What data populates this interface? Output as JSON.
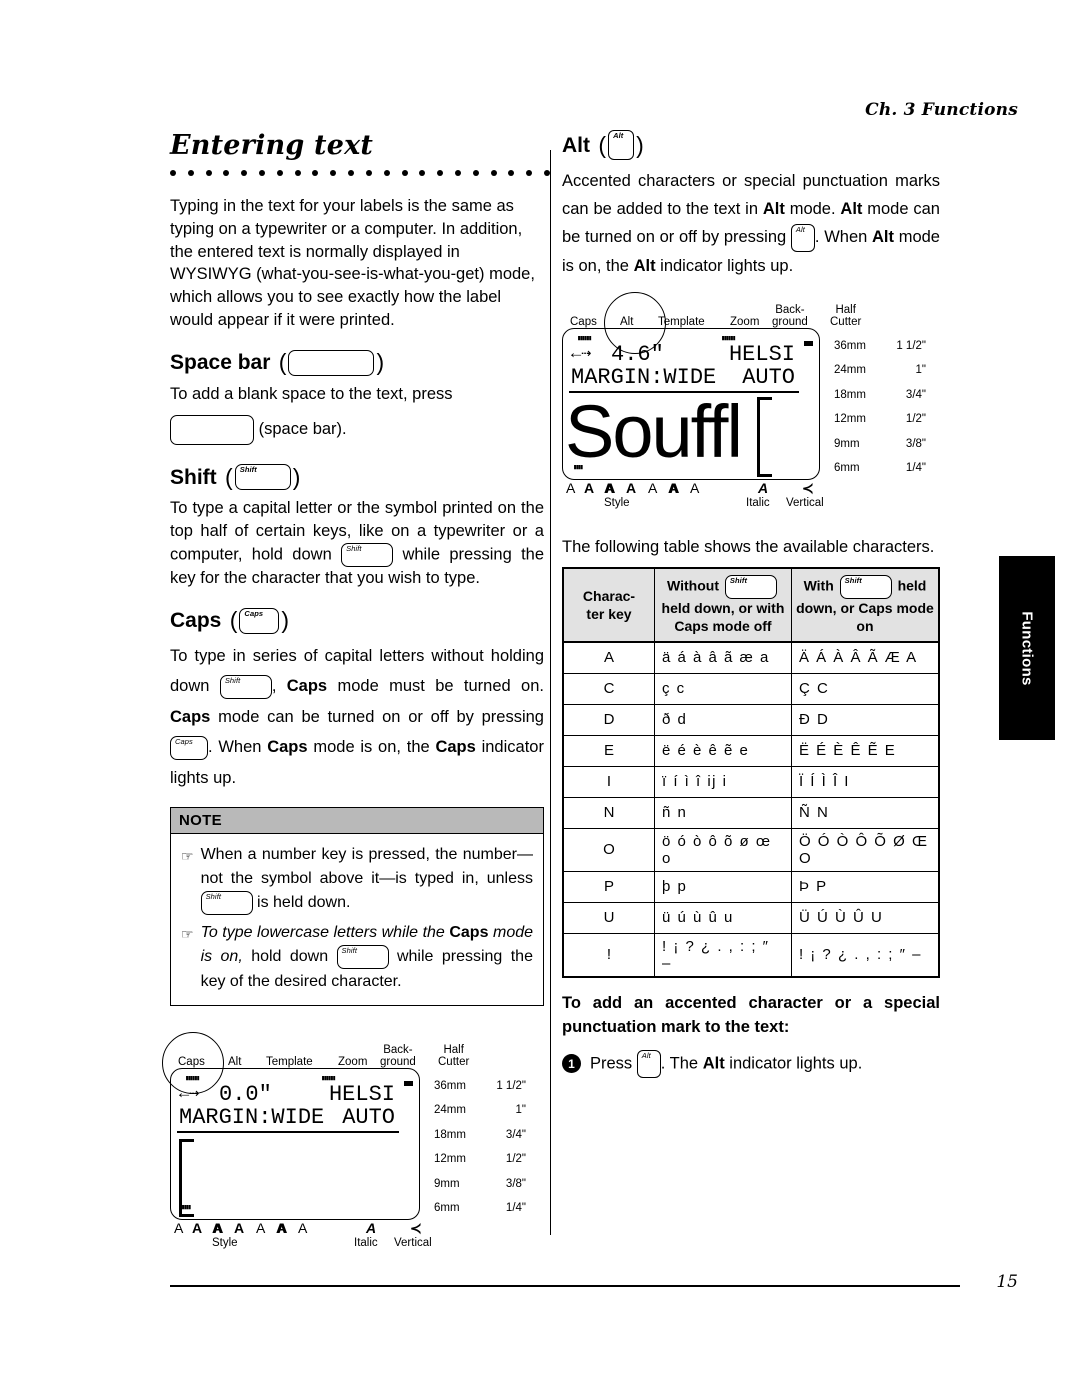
{
  "running_head": "Ch. 3 Functions",
  "page_number": "15",
  "side_tab": {
    "label": "Functions"
  },
  "left_column": {
    "section_title": "Entering text",
    "intro_paragraph": "Typing in the text for your labels is the same as typing on a typewriter or a computer. In addition, the entered text is normally displayed in WYSIWYG (what-you-see-is-what-you-get) mode, which allows you to see exactly how the label would appear if it were printed.",
    "space_bar": {
      "heading": "Space bar",
      "key_label": "",
      "text_before": "To add a blank space to the text, press",
      "text_after": "(space bar)."
    },
    "shift": {
      "heading": "Shift",
      "key_label": "Shift",
      "text_part1": "To type a capital letter or the symbol printed on the top half of certain keys, like on a typewriter or a computer, hold down",
      "text_part2": "while pressing the key for the character that you wish to type."
    },
    "caps": {
      "heading": "Caps",
      "key_label": "Caps",
      "text_part1": "To type in series of capital letters without holding down",
      "text_part2": ",",
      "text_part3": "mode must be turned on.",
      "text_part4": "mode can be turned on or off by pressing",
      "text_part5": ". When",
      "text_part6": "mode is on, the",
      "text_part7": "indicator lights up.",
      "bold_caps": "Caps"
    },
    "note": {
      "title": "NOTE",
      "item1_part1": "When a number key is pressed, the number—not the symbol above it—is typed in, unless",
      "item1_part2": "is held down.",
      "item2_part1": "To type lowercase letters while the",
      "item2_bold": "Caps",
      "item2_part2": "mode is on,",
      "item2_part3": "hold down",
      "item2_part4": "while pressing the key of the desired character."
    },
    "lcd": {
      "indicators": [
        "Caps",
        "Alt",
        "Template",
        "Zoom",
        "Back-\nground",
        "Half\nCutter"
      ],
      "highlighted_indicator": "Caps",
      "length_value": "0.0\"",
      "font_value": "HELSI",
      "margin_line": "MARGIN:WIDE",
      "size_value": "AUTO",
      "display_text": "",
      "tape_scale": [
        {
          "mm": "36mm",
          "inch": "1 1/2\""
        },
        {
          "mm": "24mm",
          "inch": "1\""
        },
        {
          "mm": "18mm",
          "inch": "3/4\""
        },
        {
          "mm": "12mm",
          "inch": "1/2\""
        },
        {
          "mm": "9mm",
          "inch": "3/8\""
        },
        {
          "mm": "6mm",
          "inch": "1/4\""
        }
      ],
      "style_glyphs": [
        "A",
        "A",
        "A",
        "A",
        "A",
        "A",
        "A"
      ],
      "style_caption": "Style",
      "italic_glyph": "A",
      "italic_caption": "Italic",
      "vertical_glyph": "≺",
      "vertical_caption": "Vertical"
    }
  },
  "right_column": {
    "alt": {
      "heading": "Alt",
      "key_label": "Alt",
      "text_part1": "Accented characters or special punctuation marks can be added to the text in",
      "bold_alt": "Alt",
      "text_part2": "mode.",
      "text_part3": "mode can be turned on or off by pressing",
      "text_part4": ". When",
      "text_part5": "mode is on, the",
      "text_part6": "indicator lights up."
    },
    "lcd": {
      "indicators": [
        "Caps",
        "Alt",
        "Template",
        "Zoom",
        "Back-\nground",
        "Half\nCutter"
      ],
      "highlighted_indicator": "Alt",
      "length_value": "4.6\"",
      "font_value": "HELSI",
      "margin_line": "MARGIN:WIDE",
      "size_value": "AUTO",
      "display_text": "Souffl",
      "tape_scale": [
        {
          "mm": "36mm",
          "inch": "1 1/2\""
        },
        {
          "mm": "24mm",
          "inch": "1\""
        },
        {
          "mm": "18mm",
          "inch": "3/4\""
        },
        {
          "mm": "12mm",
          "inch": "1/2\""
        },
        {
          "mm": "9mm",
          "inch": "3/8\""
        },
        {
          "mm": "6mm",
          "inch": "1/4\""
        }
      ],
      "style_glyphs": [
        "A",
        "A",
        "A",
        "A",
        "A",
        "A",
        "A"
      ],
      "style_caption": "Style",
      "italic_glyph": "A",
      "italic_caption": "Italic",
      "vertical_glyph": "≺",
      "vertical_caption": "Vertical"
    },
    "table_intro": "The following table shows the available characters.",
    "char_table": {
      "header_col1": "Charac-\nter key",
      "header_col2_pre": "Without",
      "header_col2_post": "held down, or with\nCaps mode off",
      "header_col3_pre": "With",
      "header_col3_mid": "held",
      "header_col3_post": "down, or Caps mode\non",
      "key_label": "Shift",
      "rows": [
        {
          "key": "A",
          "without": "ä á à â ã æ a",
          "with": "Ä Á À Â Ã Æ A"
        },
        {
          "key": "C",
          "without": "ç c",
          "with": "Ç C"
        },
        {
          "key": "D",
          "without": "ð d",
          "with": "Ð D"
        },
        {
          "key": "E",
          "without": "ë é è ê ẽ e",
          "with": "Ë É È Ê Ẽ E"
        },
        {
          "key": "I",
          "without": "ï í ì î ij i",
          "with": "Ï Í Ì Î I"
        },
        {
          "key": "N",
          "without": "ñ n",
          "with": "Ñ N"
        },
        {
          "key": "O",
          "without": "ö ó ò ô õ ø œ o",
          "with": "Ö Ó Ò Ô Õ Ø Œ O"
        },
        {
          "key": "P",
          "without": "þ p",
          "with": "Þ P"
        },
        {
          "key": "U",
          "without": "ü ú ù û u",
          "with": "Ü Ú Ù Û U"
        },
        {
          "key": "!",
          "without": "! ¡ ? ¿ . , : ; ″ –",
          "with": "! ¡ ? ¿ . , : ; ″ –"
        }
      ]
    },
    "procedure": {
      "heading": "To add an accented character or a special punctuation mark to the text:",
      "step1_num": "1",
      "step1_pre": "Press",
      "step1_post": ". The",
      "step1_bold": "Alt",
      "step1_tail": "indicator lights up.",
      "key_label": "Alt"
    }
  }
}
